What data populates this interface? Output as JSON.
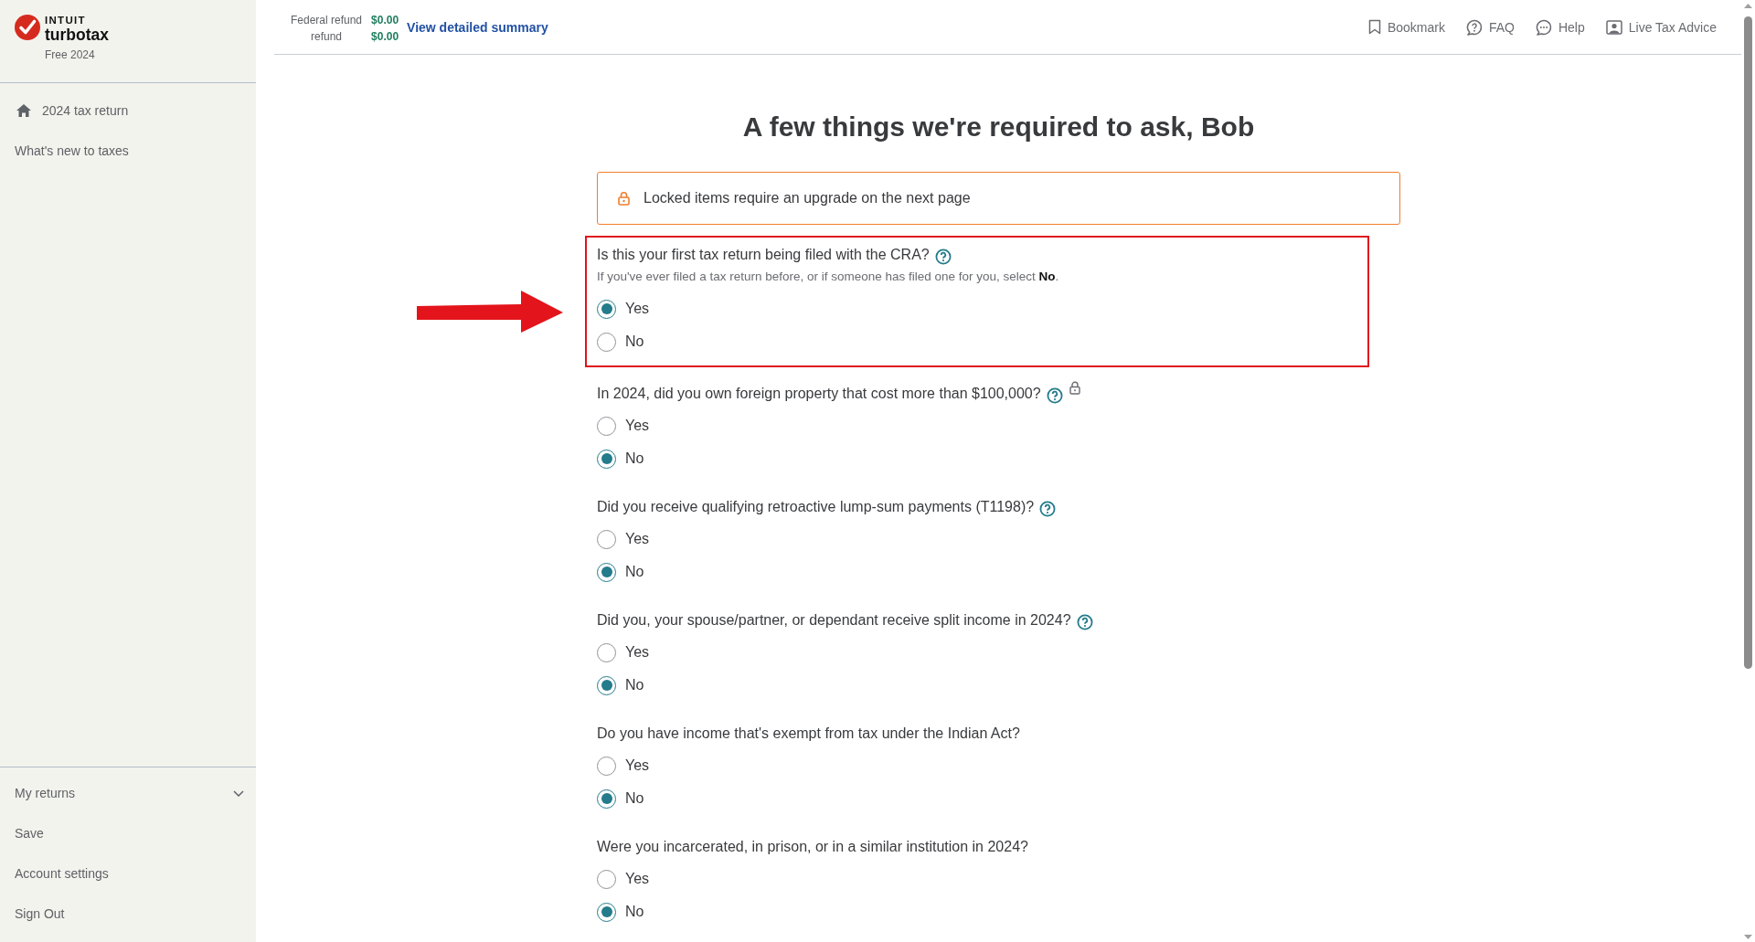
{
  "sidebar": {
    "brand": {
      "company": "INTUIT",
      "product": "turbotax",
      "edition": "Free 2024"
    },
    "top_items": [
      {
        "kind": "home",
        "label": "2024 tax return"
      },
      {
        "kind": "link",
        "label": "What's new to taxes"
      }
    ],
    "bottom_items": [
      {
        "kind": "menu",
        "label": "My returns",
        "expanded": false
      },
      {
        "kind": "link",
        "label": "Save"
      },
      {
        "kind": "link",
        "label": "Account settings"
      },
      {
        "kind": "link",
        "label": "Sign Out"
      }
    ]
  },
  "header": {
    "refunds": [
      {
        "label": "Federal refund",
        "amount": "$0.00"
      },
      {
        "label": "refund",
        "amount": "$0.00"
      }
    ],
    "summary_link": "View detailed summary",
    "nav": [
      {
        "label": "Bookmark"
      },
      {
        "label": "FAQ"
      },
      {
        "label": "Help"
      },
      {
        "label": "Live Tax Advice"
      }
    ]
  },
  "page": {
    "title": "A few things we're required to ask, Bob",
    "notice": "Locked items require an upgrade on the next page",
    "questions": [
      {
        "text": "Is this your first tax return being filed with the CRA?",
        "help": true,
        "locked": false,
        "highlighted": true,
        "hint": "If you've ever filed a tax return before, or if someone has filed one for you, select **No**.",
        "options": [
          {
            "label": "Yes",
            "selected": true
          },
          {
            "label": "No",
            "selected": false
          }
        ]
      },
      {
        "text": "In 2024, did you own foreign property that cost more than $100,000?",
        "help": true,
        "locked": true,
        "highlighted": false,
        "options": [
          {
            "label": "Yes",
            "selected": false
          },
          {
            "label": "No",
            "selected": true
          }
        ]
      },
      {
        "text": "Did you receive qualifying retroactive lump-sum payments (T1198)?",
        "help": true,
        "locked": false,
        "highlighted": false,
        "options": [
          {
            "label": "Yes",
            "selected": false
          },
          {
            "label": "No",
            "selected": true
          }
        ]
      },
      {
        "text": "Did you, your spouse/partner, or dependant receive split income in 2024?",
        "help": true,
        "locked": false,
        "highlighted": false,
        "options": [
          {
            "label": "Yes",
            "selected": false
          },
          {
            "label": "No",
            "selected": true
          }
        ]
      },
      {
        "text": "Do you have income that's exempt from tax under the Indian Act?",
        "help": false,
        "locked": false,
        "highlighted": false,
        "options": [
          {
            "label": "Yes",
            "selected": false
          },
          {
            "label": "No",
            "selected": true
          }
        ]
      },
      {
        "text": "Were you incarcerated, in prison, or in a similar institution in 2024?",
        "help": false,
        "locked": false,
        "highlighted": false,
        "options": [
          {
            "label": "Yes",
            "selected": false
          },
          {
            "label": "No",
            "selected": true
          }
        ]
      }
    ]
  }
}
